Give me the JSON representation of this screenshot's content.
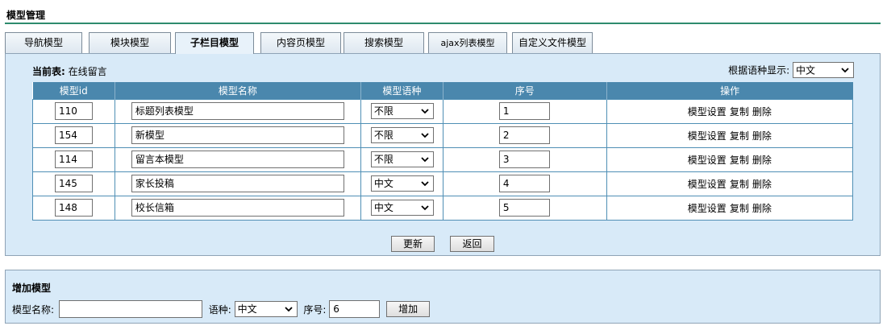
{
  "header": {
    "title": "模型管理"
  },
  "tabs": [
    {
      "label": "导航模型"
    },
    {
      "label": "模块模型"
    },
    {
      "label": "子栏目模型"
    },
    {
      "label": "内容页模型"
    },
    {
      "label": "搜索模型"
    },
    {
      "label": "ajax列表模型"
    },
    {
      "label": "自定义文件模型"
    }
  ],
  "active_tab": "子栏目模型",
  "current": {
    "label": "当前表:",
    "value": "在线留言"
  },
  "lang_filter": {
    "label": "根据语种显示:",
    "value": "中文"
  },
  "table": {
    "columns": [
      "模型id",
      "模型名称",
      "模型语种",
      "序号",
      "操作"
    ],
    "rows": [
      {
        "id": "110",
        "name": "标题列表模型",
        "lang": "不限",
        "order": "1"
      },
      {
        "id": "154",
        "name": "新模型",
        "lang": "不限",
        "order": "2"
      },
      {
        "id": "114",
        "name": "留言本模型",
        "lang": "不限",
        "order": "3"
      },
      {
        "id": "145",
        "name": "家长投稿",
        "lang": "中文",
        "order": "4"
      },
      {
        "id": "148",
        "name": "校长信箱",
        "lang": "中文",
        "order": "5"
      }
    ],
    "row_actions": {
      "settings": "模型设置",
      "copy": "复制",
      "delete": "删除"
    }
  },
  "buttons": {
    "update": "更新",
    "back": "返回"
  },
  "add_model": {
    "title": "增加模型",
    "name_label": "模型名称:",
    "name_value": "",
    "lang_label": "语种:",
    "lang_value": "中文",
    "order_label": "序号:",
    "order_value": "6",
    "add_button": "增加"
  },
  "colors": {
    "panel_bg": "#d8eaf8",
    "header_bg": "#4a87ad",
    "title_line": "#2e8b6d"
  }
}
